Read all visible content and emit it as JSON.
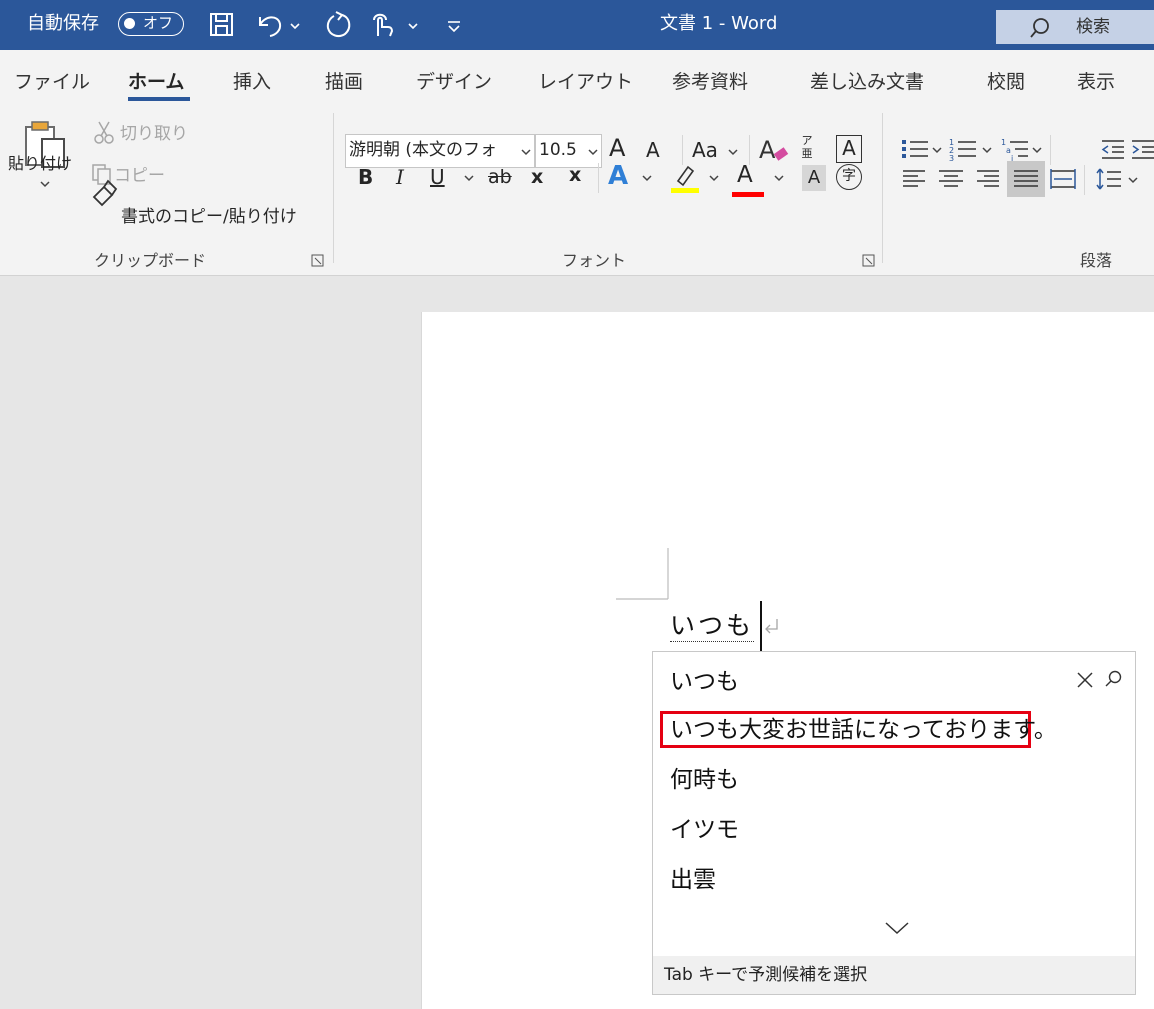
{
  "titlebar": {
    "autosave_label": "自動保存",
    "autosave_state": "オフ",
    "document_title": "文書 1  -  Word",
    "search_label": "検索",
    "background_color": "#2b579a"
  },
  "tabs": [
    {
      "label": "ファイル"
    },
    {
      "label": "ホーム",
      "active": true
    },
    {
      "label": "挿入"
    },
    {
      "label": "描画"
    },
    {
      "label": "デザイン"
    },
    {
      "label": "レイアウト"
    },
    {
      "label": "参考資料"
    },
    {
      "label": "差し込み文書"
    },
    {
      "label": "校閲"
    },
    {
      "label": "表示"
    }
  ],
  "clipboard": {
    "paste_label": "貼り付け",
    "cut_label": "切り取り",
    "copy_label": "コピー",
    "format_painter_label": "書式のコピー/貼り付け",
    "group_label": "クリップボード"
  },
  "font": {
    "font_name": "游明朝 (本文のフォ",
    "font_size": "10.5",
    "grow_label": "A",
    "shrink_label": "A",
    "case_label": "Aa",
    "phonetic_label": "ア亜",
    "border_label": "A",
    "bold_label": "B",
    "italic_label": "I",
    "underline_label": "U",
    "strike_label": "ab",
    "subscript_label": "x",
    "superscript_label": "x",
    "effects_label": "A",
    "color_label": "A",
    "shading_label": "A",
    "enclose_label": "字",
    "group_label": "フォント",
    "highlight_color": "#ffff00",
    "font_color": "#ff0000"
  },
  "paragraph": {
    "group_label": "段落"
  },
  "document": {
    "typed_text": "いつも"
  },
  "prediction": {
    "query": "いつも",
    "candidates": [
      "いつも大変お世話になっております。",
      "何時も",
      "イツモ",
      "出雲"
    ],
    "footer": "Tab キーで予測候補を選択",
    "highlight_color": "#e50012"
  }
}
